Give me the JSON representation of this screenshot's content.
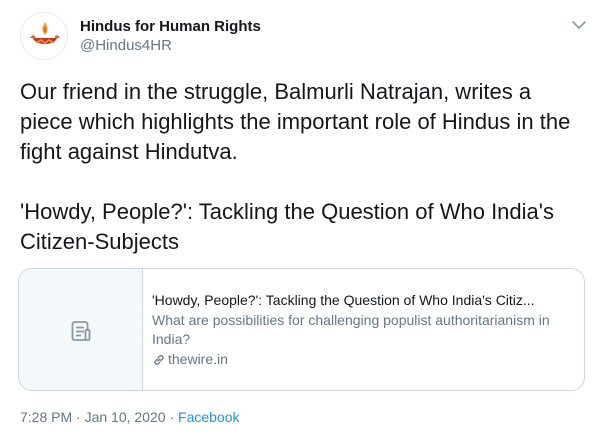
{
  "author": {
    "display_name": "Hindus for Human Rights",
    "handle": "@Hindus4HR",
    "avatar_icon": "diya-lamp-icon"
  },
  "tweet": {
    "lines": [
      "Our friend in the struggle, Balmurli Natrajan, writes a",
      "piece which highlights the important role of Hindus in the",
      "fight against Hindutva."
    ],
    "link_lines": [
      "'Howdy, People?': Tackling the Question of Who India's",
      "Citizen-Subjects"
    ]
  },
  "card": {
    "thumb_icon": "document-icon",
    "title": "'Howdy, People?': Tackling the Question of Who India's Citiz...",
    "description": "What are possibilities for challenging populist authoritarianism in India?",
    "domain_icon": "link-icon",
    "domain": "thewire.in"
  },
  "meta": {
    "time": "7:28 PM",
    "separator1": " · ",
    "date": "Jan 10, 2020",
    "separator2": " · ",
    "source": "Facebook"
  },
  "colors": {
    "text": "#14171a",
    "secondary": "#657786",
    "link": "#1b95e0",
    "border": "#ccd6dd",
    "avatar_flame": "#e8641c",
    "avatar_bowl": "#c0392b"
  }
}
